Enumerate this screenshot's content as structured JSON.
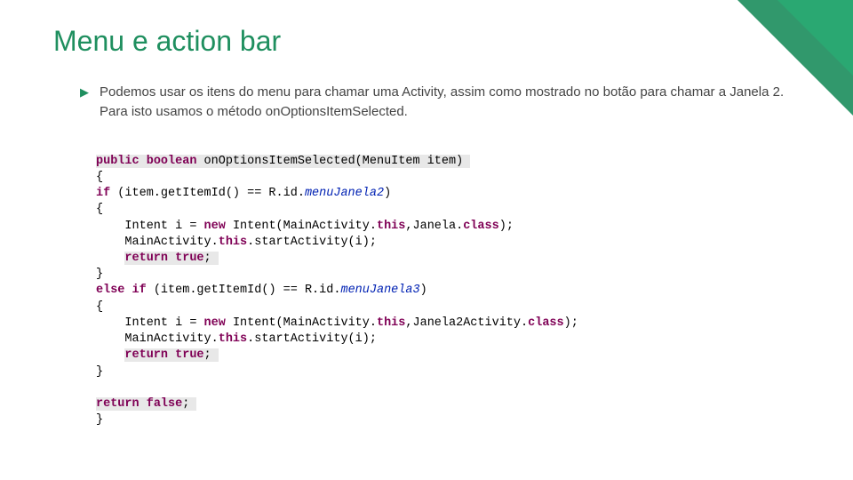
{
  "title": "Menu e action bar",
  "bullet": "Podemos usar os itens do menu para chamar uma Activity, assim como mostrado no botão para chamar a Janela 2. Para isto usamos o método onOptionsItemSelected.",
  "code": {
    "l1a": "public",
    "l1b": " ",
    "l1c": "boolean",
    "l1d": " onOptionsItemSelected(MenuItem item) ",
    "l2": "{",
    "l3a": "if",
    "l3b": " (item.getItemId() == R.id.",
    "l3c": "menuJanela2",
    "l3d": ")",
    "l4": "{",
    "l5a": "    Intent i = ",
    "l5b": "new",
    "l5c": " Intent(MainActivity.",
    "l5d": "this",
    "l5e": ",Janela.",
    "l5f": "class",
    "l5g": ");",
    "l6a": "    MainActivity.",
    "l6b": "this",
    "l6c": ".startActivity(i);",
    "l7a": "    ",
    "l7b": "return",
    "l7c": " ",
    "l7d": "true",
    "l7e": "; ",
    "l8": "}",
    "l9a": "else",
    "l9b": " ",
    "l9c": "if",
    "l9d": " (item.getItemId() == R.id.",
    "l9e": "menuJanela3",
    "l9f": ")",
    "l10": "{",
    "l11a": "    Intent i = ",
    "l11b": "new",
    "l11c": " Intent(MainActivity.",
    "l11d": "this",
    "l11e": ",Janela2Activity.",
    "l11f": "class",
    "l11g": ");",
    "l12a": "    MainActivity.",
    "l12b": "this",
    "l12c": ".startActivity(i);",
    "l13a": "    ",
    "l13b": "return",
    "l13c": " ",
    "l13d": "true",
    "l13e": "; ",
    "l14": "}",
    "blank": "",
    "l15a": "return",
    "l15b": " ",
    "l15c": "false",
    "l15d": "; ",
    "l16": "}"
  }
}
